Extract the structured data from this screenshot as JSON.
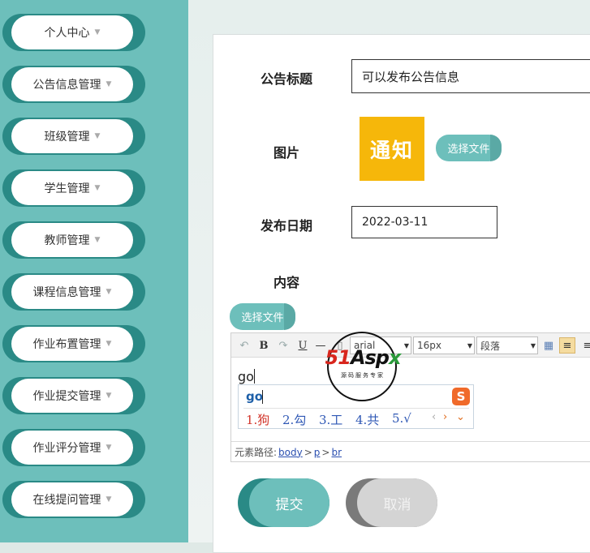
{
  "sidebar": {
    "items": [
      {
        "label": "个人中心"
      },
      {
        "label": "公告信息管理"
      },
      {
        "label": "班级管理"
      },
      {
        "label": "学生管理"
      },
      {
        "label": "教师管理"
      },
      {
        "label": "课程信息管理"
      },
      {
        "label": "作业布置管理"
      },
      {
        "label": "作业提交管理"
      },
      {
        "label": "作业评分管理"
      },
      {
        "label": "在线提问管理"
      }
    ]
  },
  "form": {
    "title_label": "公告标题",
    "title_value": "可以发布公告信息",
    "image_label": "图片",
    "image_text": "通知",
    "image_button": "选择文件",
    "date_label": "发布日期",
    "date_value": "2022-03-11",
    "content_label": "内容",
    "content_file_button": "选择文件"
  },
  "editor": {
    "toolbar": {
      "bold": "B",
      "underline": "U",
      "font_family": "arial",
      "font_size": "16px",
      "paragraph": "段落"
    },
    "typed_text": "go",
    "path_label": "元素路径:",
    "path": [
      "body",
      "p",
      "br"
    ]
  },
  "ime": {
    "pinyin": "go",
    "logo": "S",
    "candidates": [
      "1.狗",
      "2.勾",
      "3.工",
      "4.共",
      "5.√"
    ]
  },
  "watermark": {
    "logo_a": "51",
    "logo_b": "Asp",
    "logo_c": "x",
    "sub": "源码服务专家"
  },
  "actions": {
    "submit": "提交",
    "cancel": "取消"
  },
  "colors": {
    "sidebar": "#6dbfbb",
    "accent_dark": "#2a8a86",
    "notice": "#f6b70a"
  }
}
